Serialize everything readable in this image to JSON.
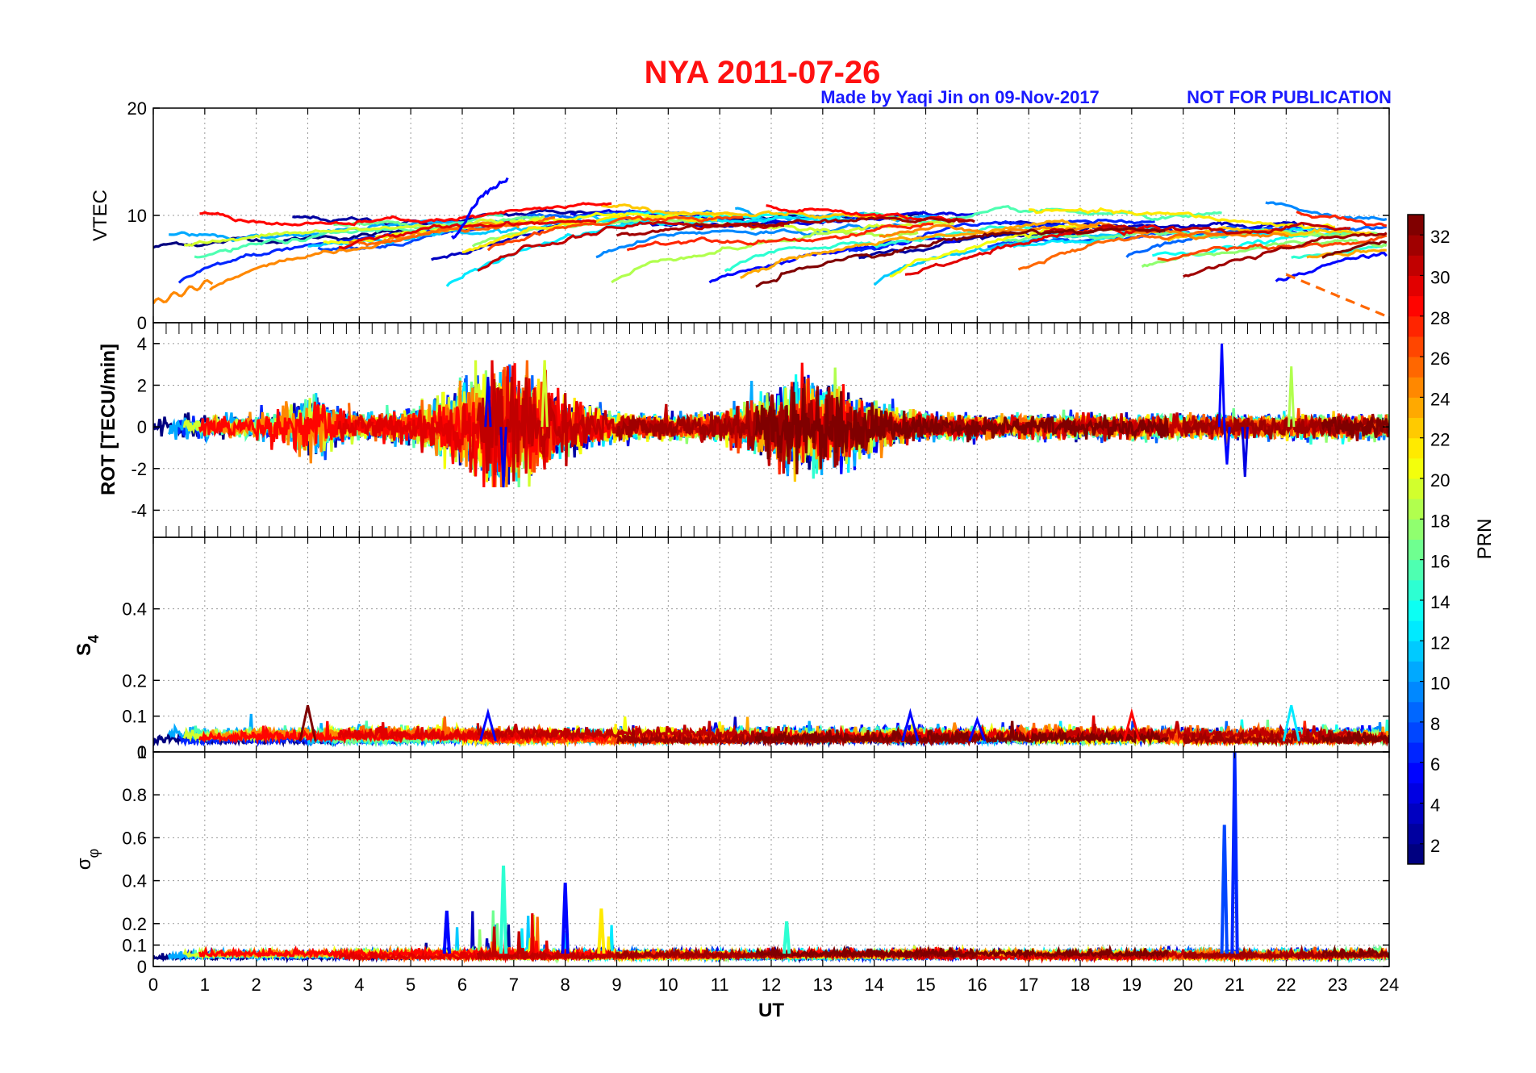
{
  "figure": {
    "title": "NYA   2011-07-26",
    "title_color": "#ff1111",
    "credit": "Made by Yaqi Jin on 09-Nov-2017",
    "notice": "NOT FOR PUBLICATION",
    "note_color": "#1a1aff"
  },
  "chart_data": [
    {
      "type": "line",
      "panel": "vtec",
      "ylabel": "VTEC",
      "ylim": [
        0,
        20
      ],
      "yticks": [
        "0",
        "10",
        "20"
      ],
      "xlim": [
        0,
        24
      ],
      "grid": true,
      "description_of_series": "one line per PRN, coloured by PRN",
      "series_summary": {
        "baseline_range": [
          6,
          12
        ],
        "peak_value": 14.2,
        "peak_time_ut": 6.8,
        "low_track_start": 2.0,
        "low_track_end": 0.5
      }
    },
    {
      "type": "line",
      "panel": "rot",
      "ylabel": "ROT [TECU/min]",
      "ylim": [
        -5.3,
        5
      ],
      "yticks": [
        "-4",
        "-2",
        "0",
        "2",
        "4"
      ],
      "xlim": [
        0,
        24
      ],
      "grid": true,
      "series_summary": {
        "max": 4.0,
        "max_time_ut": 20.8,
        "min": -2.9,
        "min_time_ut": 6.8
      }
    },
    {
      "type": "line",
      "panel": "s4",
      "ylabel": "S4",
      "ylim": [
        0,
        0.6
      ],
      "yticks": [
        "0",
        "0.1",
        "0.2",
        "0.4"
      ],
      "xlim": [
        0,
        24
      ],
      "grid": true,
      "series_summary": {
        "baseline": 0.03,
        "max": 0.13,
        "max_time_ut": 3.0
      }
    },
    {
      "type": "line",
      "panel": "sigma_phi",
      "ylabel": "σφ",
      "ylim": [
        0,
        1
      ],
      "yticks": [
        "0",
        "0.1",
        "0.2",
        "0.4",
        "0.6",
        "0.8",
        "1"
      ],
      "xlim": [
        0,
        24
      ],
      "xlabel": "UT",
      "xticks": [
        "0",
        "1",
        "2",
        "3",
        "4",
        "5",
        "6",
        "7",
        "8",
        "9",
        "10",
        "11",
        "12",
        "13",
        "14",
        "15",
        "16",
        "17",
        "18",
        "19",
        "20",
        "21",
        "22",
        "23",
        "24"
      ],
      "grid": true,
      "series_summary": {
        "baseline": 0.05,
        "spikes": [
          {
            "ut": 5.7,
            "value": 0.26
          },
          {
            "ut": 6.8,
            "value": 0.47
          },
          {
            "ut": 8.0,
            "value": 0.39
          },
          {
            "ut": 8.7,
            "value": 0.27
          },
          {
            "ut": 12.3,
            "value": 0.21
          },
          {
            "ut": 20.8,
            "value": 0.66
          },
          {
            "ut": 21.0,
            "value": 1.0
          }
        ]
      }
    }
  ],
  "colorbar": {
    "label": "PRN",
    "range": [
      1,
      33
    ],
    "ticks": [
      "2",
      "4",
      "6",
      "8",
      "10",
      "12",
      "14",
      "16",
      "18",
      "20",
      "22",
      "24",
      "26",
      "28",
      "30",
      "32"
    ],
    "colormap": "jet"
  }
}
